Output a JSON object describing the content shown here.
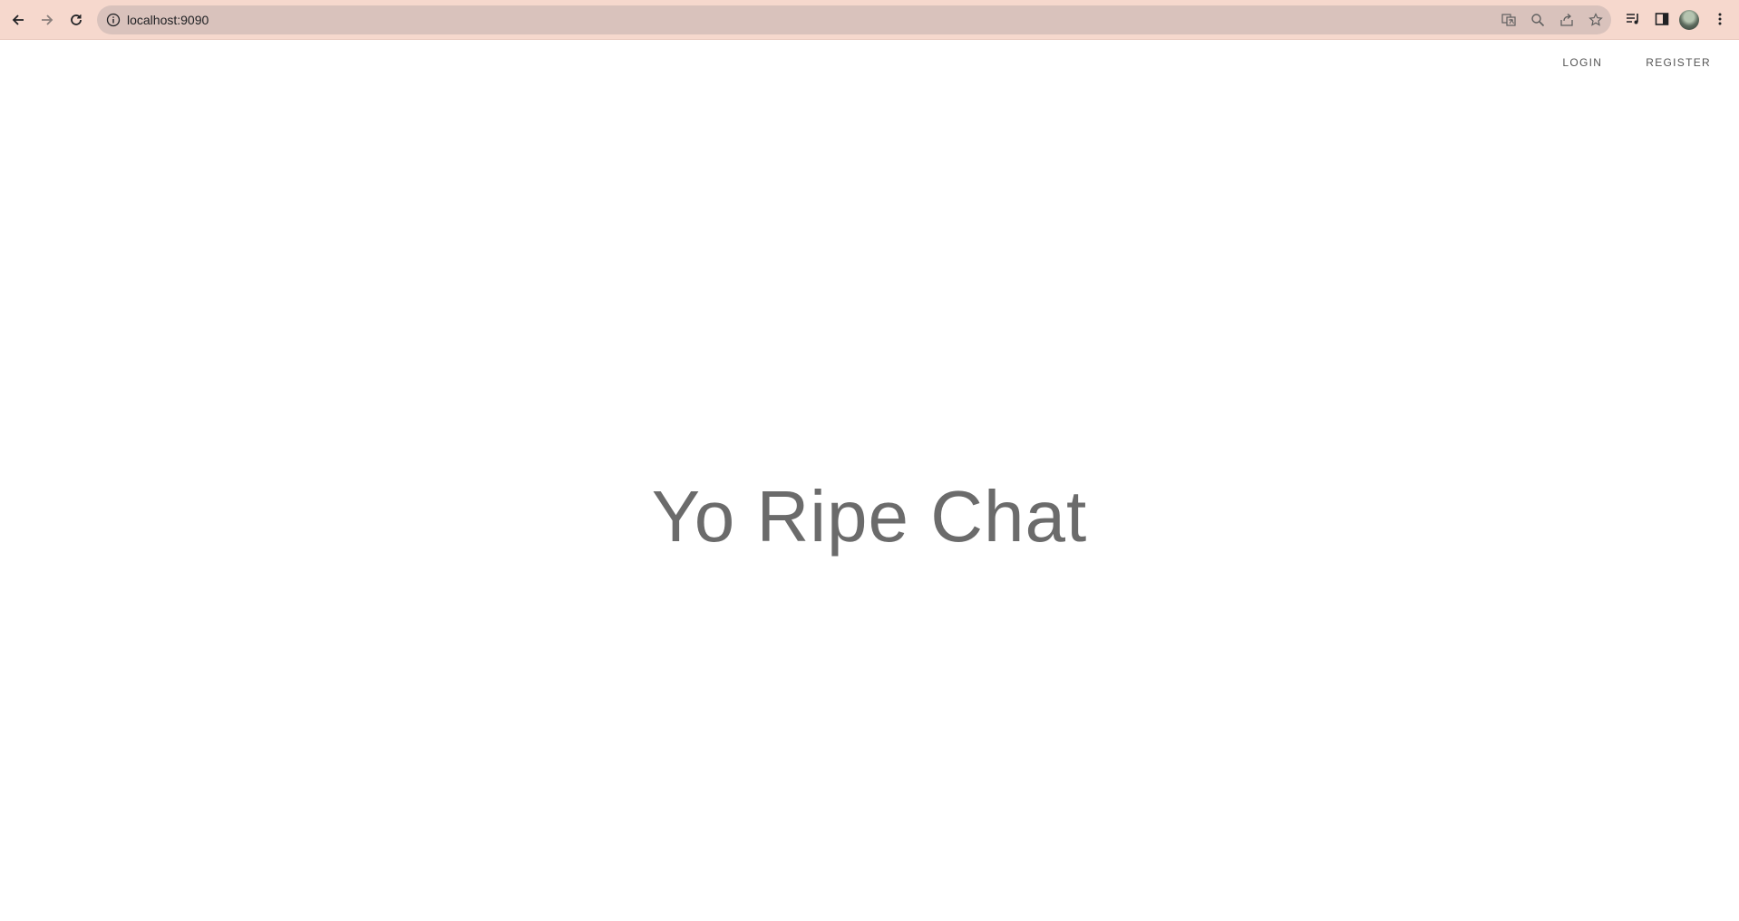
{
  "browser": {
    "url": "localhost:9090"
  },
  "nav": {
    "login_label": "LOGIN",
    "register_label": "REGISTER"
  },
  "hero": {
    "title": "Yo Ripe Chat"
  },
  "colors": {
    "browser_bar": "#f6d8cd",
    "omnibox": "#d9c2bc",
    "title_text": "#6b6b6b",
    "nav_text": "#555555"
  }
}
